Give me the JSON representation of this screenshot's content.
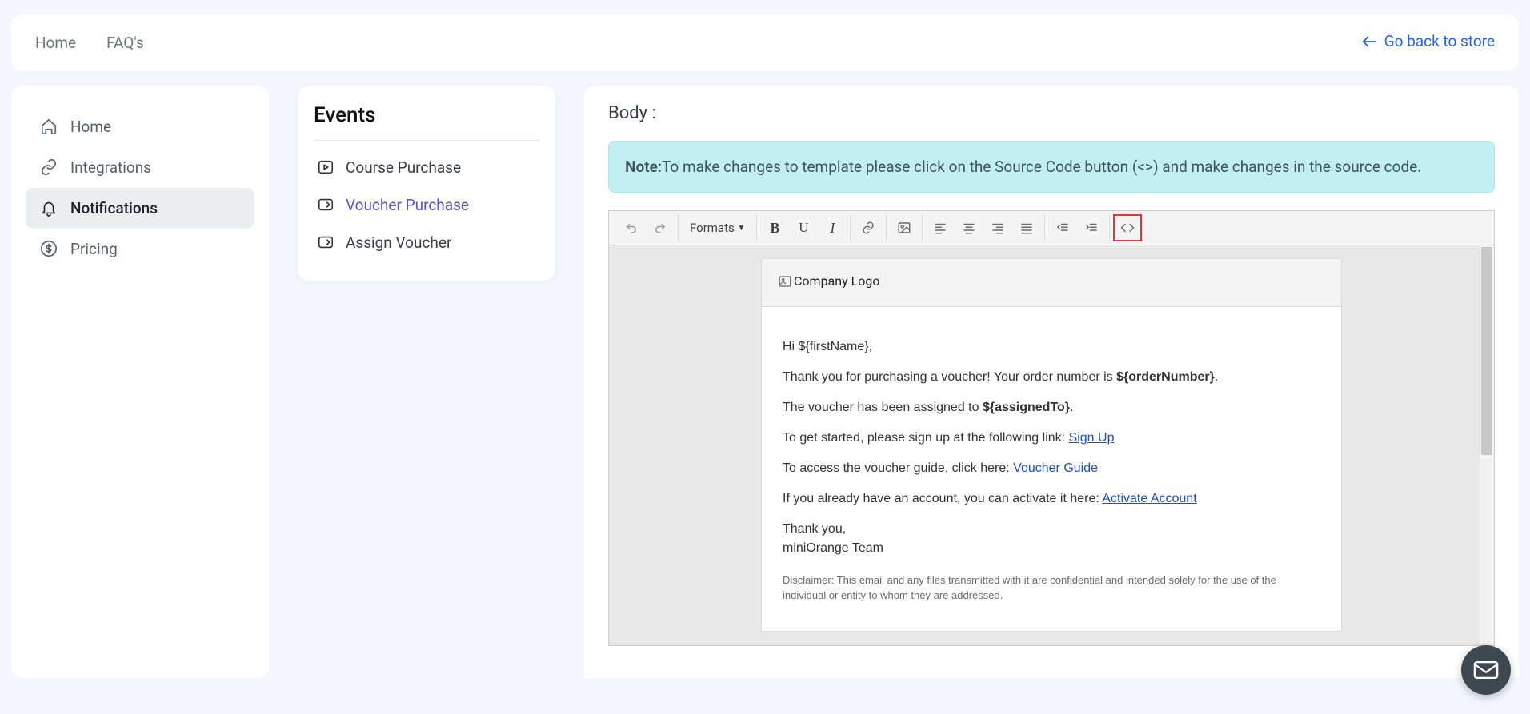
{
  "topbar": {
    "home": "Home",
    "faqs": "FAQ's",
    "back": "Go back to store"
  },
  "sidebar": {
    "items": [
      {
        "label": "Home"
      },
      {
        "label": "Integrations"
      },
      {
        "label": "Notifications"
      },
      {
        "label": "Pricing"
      }
    ]
  },
  "events": {
    "title": "Events",
    "items": [
      {
        "label": "Course Purchase"
      },
      {
        "label": "Voucher Purchase"
      },
      {
        "label": "Assign Voucher"
      }
    ]
  },
  "content": {
    "body_label": "Body :",
    "note_bold": "Note:",
    "note_text": "To make changes to template please click on the Source Code button (<>) and make changes in the source code."
  },
  "toolbar": {
    "formats": "Formats"
  },
  "mail": {
    "logo_alt": "Company Logo",
    "greeting": "Hi ${firstName},",
    "line1_a": "Thank you for purchasing a voucher! Your order number is ",
    "order_var": "${orderNumber}",
    "line1_b": ".",
    "line2_a": "The voucher has been assigned to ",
    "assigned_var": "${assignedTo}",
    "line2_b": ".",
    "line3_a": "To get started, please sign up at the following link: ",
    "link_signup": "Sign Up",
    "line4_a": "To access the voucher guide, click here: ",
    "link_guide": "Voucher Guide",
    "line5_a": "If you already have an account, you can activate it here: ",
    "link_activate": "Activate Account",
    "thanks1": "Thank you,",
    "thanks2": "miniOrange Team",
    "disclaimer": "Disclaimer: This email and any files transmitted with it are confidential and intended solely for the use of the individual or entity to whom they are addressed."
  }
}
